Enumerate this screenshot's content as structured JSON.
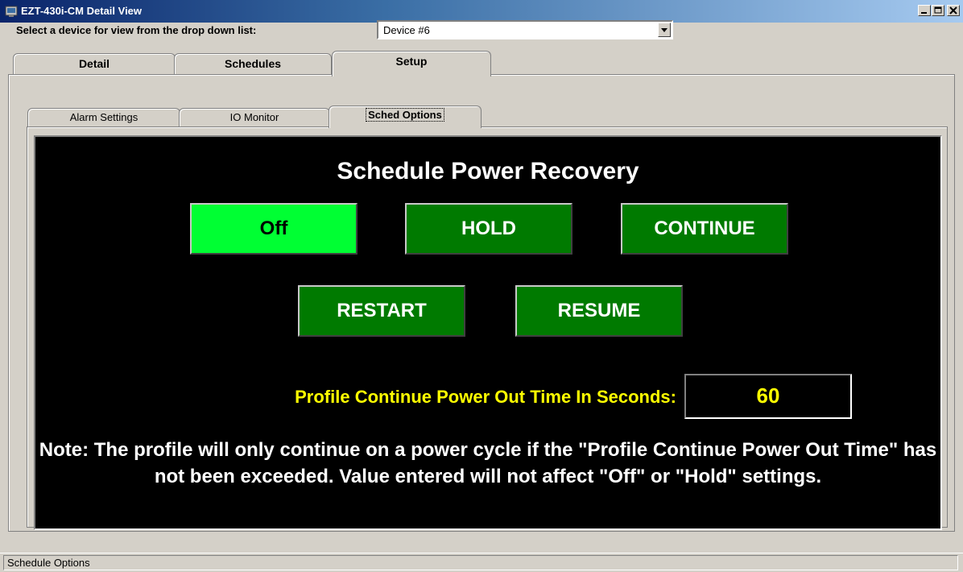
{
  "window": {
    "title": "EZT-430i-CM Detail View",
    "icon": "app-icon",
    "controls": [
      "minimize-icon",
      "maximize-icon",
      "close-icon"
    ]
  },
  "device_select": {
    "label": "Select a device for view from the drop down list:",
    "value": "Device #6"
  },
  "main_tabs": [
    {
      "label": "Detail",
      "active": false
    },
    {
      "label": "Schedules",
      "active": false
    },
    {
      "label": "Setup",
      "active": true
    }
  ],
  "sub_tabs": [
    {
      "label": "Alarm Settings",
      "active": false
    },
    {
      "label": "IO Monitor",
      "active": false
    },
    {
      "label": "Sched Options",
      "active": true
    }
  ],
  "panel": {
    "title": "Schedule Power Recovery",
    "options": [
      {
        "label": "Off",
        "selected": true
      },
      {
        "label": "HOLD",
        "selected": false
      },
      {
        "label": "CONTINUE",
        "selected": false
      },
      {
        "label": "RESTART",
        "selected": false
      },
      {
        "label": "RESUME",
        "selected": false
      }
    ],
    "time_label": "Profile Continue Power Out Time In Seconds:",
    "time_value": "60",
    "note": "Note: The profile will only continue on a power cycle if the \"Profile Continue Power Out Time\" has not been exceeded.  Value entered will not affect \"Off\" or \"Hold\" settings."
  },
  "status_bar": {
    "text": "Schedule Options"
  },
  "colors": {
    "panel_background": "#000000",
    "option_button": "#007a00",
    "option_selected": "#00ff33",
    "accent_text": "#ffff00",
    "title_bar": "#0a246a"
  }
}
